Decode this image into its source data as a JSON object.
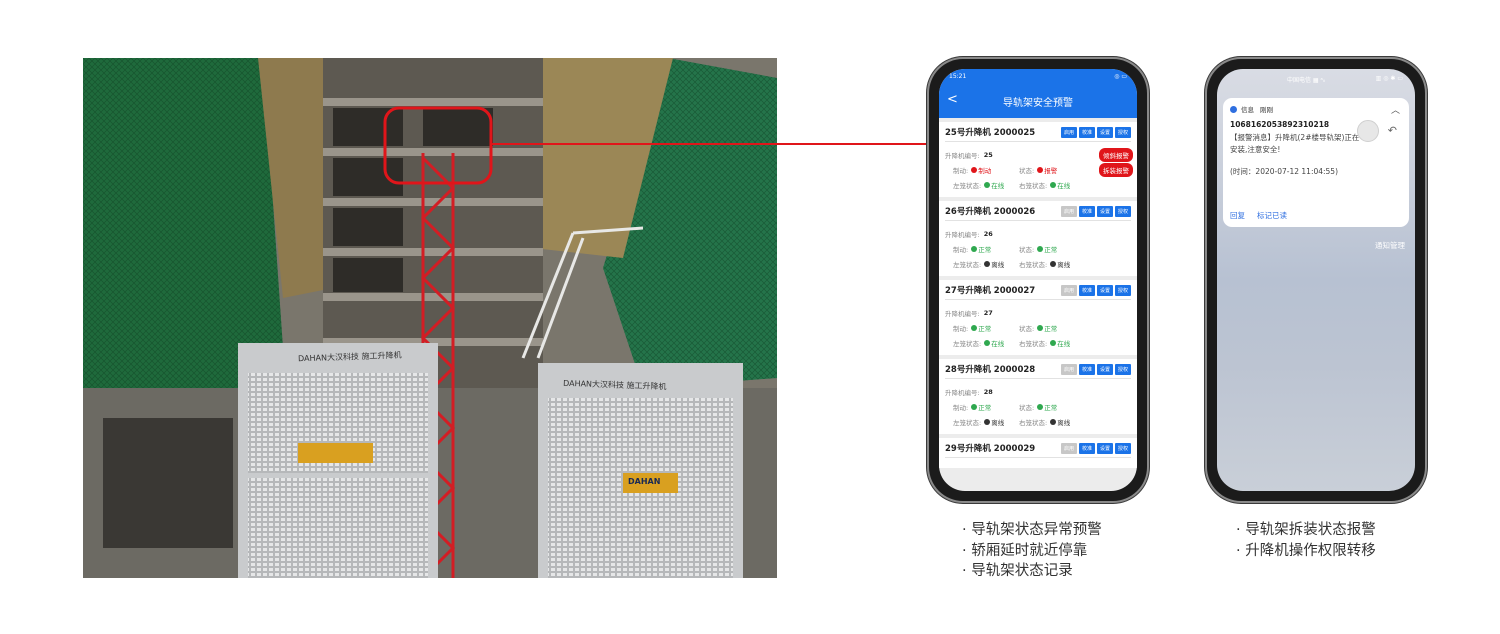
{
  "phone1": {
    "status_time": "15:21",
    "status_right": "◎ ▭",
    "header_title": "导轨架安全预警",
    "back_label": "<",
    "cards": [
      {
        "title": "25号升降机 2000025",
        "buttons": [
          "启用",
          "校准",
          "设置",
          "授权"
        ],
        "id_label": "升降机编号:",
        "id_value": "25",
        "brake_label": "制动:",
        "brake_value": "制动",
        "state_label": "状态:",
        "state_value": "报警",
        "left_label": "左笼状态:",
        "left_value": "在线",
        "right_label": "右笼状态:",
        "right_value": "在线",
        "alarm_1": "倾斜报警",
        "alarm_2": "拆装报警"
      },
      {
        "title": "26号升降机 2000026",
        "buttons": [
          "启用",
          "校准",
          "设置",
          "授权"
        ],
        "id_label": "升降机编号:",
        "id_value": "26",
        "brake_label": "制动:",
        "brake_value": "正常",
        "state_label": "状态:",
        "state_value": "正常",
        "left_label": "左笼状态:",
        "left_value": "离线",
        "right_label": "右笼状态:",
        "right_value": "离线"
      },
      {
        "title": "27号升降机 2000027",
        "buttons": [
          "启用",
          "校准",
          "设置",
          "授权"
        ],
        "id_label": "升降机编号:",
        "id_value": "27",
        "brake_label": "制动:",
        "brake_value": "正常",
        "state_label": "状态:",
        "state_value": "正常",
        "left_label": "左笼状态:",
        "left_value": "在线",
        "right_label": "右笼状态:",
        "right_value": "在线"
      },
      {
        "title": "28号升降机 2000028",
        "buttons": [
          "启用",
          "校准",
          "设置",
          "授权"
        ],
        "id_label": "升降机编号:",
        "id_value": "28",
        "brake_label": "制动:",
        "brake_value": "正常",
        "state_label": "状态:",
        "state_value": "正常",
        "left_label": "左笼状态:",
        "left_value": "离线",
        "right_label": "右笼状态:",
        "right_value": "离线"
      },
      {
        "title": "29号升降机 2000029",
        "buttons": [
          "启用",
          "校准",
          "设置",
          "授权"
        ]
      }
    ]
  },
  "phone2": {
    "status_left": "中国电信 ▦ ᵃᵢᵢ",
    "status_right": "▥ ◎ ✱ ▭",
    "app_name": "信息",
    "time_ago": "刚刚",
    "sender": "1068162053892310218",
    "body_line1": "【报警消息】升降机(2#楼导轨架)正在安装,注意安全!",
    "body_line2": "(时间：2020-07-12 11:04:55)",
    "action_reply": "回复",
    "action_mark_read": "标记已读",
    "notif_manage": "通知管理"
  },
  "captions": {
    "left": [
      "导轨架状态异常预警",
      "轿厢延时就近停靠",
      "导轨架状态记录"
    ],
    "right": [
      "导轨架拆装状态报警",
      "升降机操作权限转移"
    ]
  },
  "photo": {
    "sign_left": "DAHAN大汉科技  施工升降机",
    "sign_right": "DAHAN大汉科技  施工升降机",
    "logo": "DAHAN"
  },
  "colors": {
    "accent_blue": "#1b73e8",
    "alarm_red": "#e0151a",
    "ok_green": "#2fa84f"
  }
}
